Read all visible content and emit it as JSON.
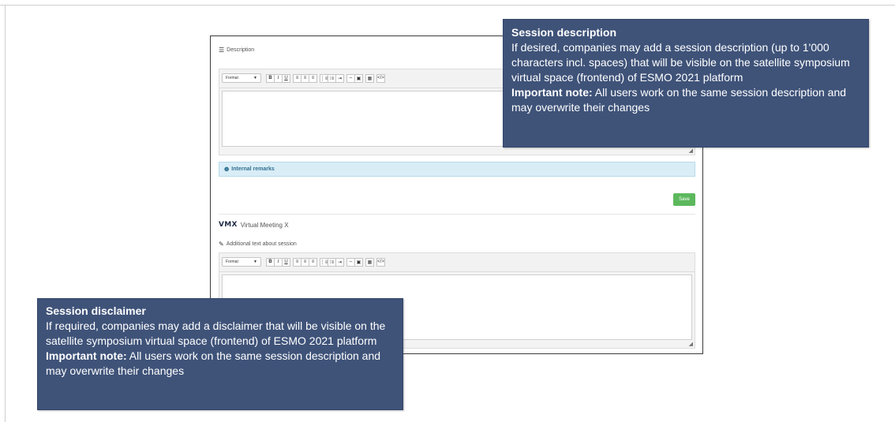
{
  "description_section": {
    "label": "Description",
    "toolbar": {
      "format_label": "Format",
      "bold": "B",
      "italic": "I",
      "underline": "U",
      "align_left": "≡",
      "align_center": "≡",
      "align_right": "≡",
      "bullet_list": "⋮≡",
      "numbered_list": "⁝≡",
      "indent": "⇥",
      "link": "⇔",
      "image": "▣",
      "table": "▦",
      "source": "</>"
    }
  },
  "internal_remarks": {
    "label": "Internal remarks"
  },
  "save_button": {
    "label": "Save"
  },
  "vmx": {
    "logo": "VMX",
    "title": "Virtual Meeting X"
  },
  "additional_text": {
    "label": "Additional text about session"
  },
  "callout_description": {
    "title": "Session description",
    "body": "If desired, companies may add a session description (up to 1'000 characters incl. spaces) that will be visible on the satellite symposium virtual space (frontend) of ESMO 2021 platform",
    "note_label": "Important note:",
    "note_text": " All users work on the same session description and may overwrite their changes"
  },
  "callout_disclaimer": {
    "title": "Session disclaimer",
    "body": "If required, companies may add a disclaimer that will be visible on the satellite symposium virtual space (frontend) of ESMO 2021 platform",
    "note_label": "Important note:",
    "note_text": " All users work on the same session description and may overwrite their changes"
  },
  "colors": {
    "callout_bg": "#3f5379",
    "save_green": "#5cb85c",
    "remarks_bg": "#d9edf7"
  }
}
